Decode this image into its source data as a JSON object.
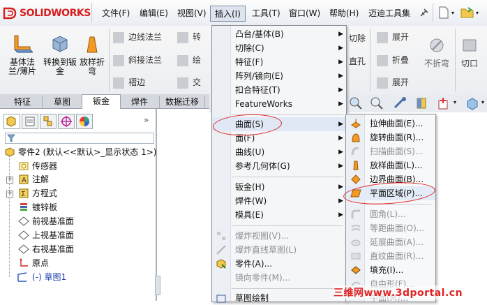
{
  "app": {
    "logo_text": "SOLIDWORKS",
    "menu": [
      "文件(F)",
      "编辑(E)",
      "视图(V)",
      "插入(I)",
      "工具(T)",
      "窗口(W)",
      "帮助(H)",
      "迈迪工具集"
    ]
  },
  "ribbon": {
    "big_buttons": [
      {
        "label": "基体法兰/薄片",
        "icon": "base-flange-icon"
      },
      {
        "label": "转换到钣金",
        "icon": "convert-sheet-metal-icon"
      },
      {
        "label": "放样折弯",
        "icon": "lofted-bend-icon"
      }
    ],
    "small_buttons": [
      {
        "label": "边线法兰",
        "icon": "edge-flange-icon"
      },
      {
        "label": "斜接法兰",
        "icon": "miter-flange-icon"
      },
      {
        "label": "褶边",
        "icon": "hem-icon"
      },
      {
        "label": "转",
        "icon": "jog-icon"
      },
      {
        "label": "绘",
        "icon": "sketched-bend-icon"
      },
      {
        "label": "交",
        "icon": "cross-break-icon"
      }
    ],
    "right_buttons": [
      {
        "label": "切除",
        "icon": "cut-icon"
      },
      {
        "label": "直孔",
        "icon": "hole-icon"
      },
      {
        "label": "展开",
        "icon": "unfold-icon"
      },
      {
        "label": "折叠",
        "icon": "fold-icon"
      },
      {
        "label": "展开",
        "icon": "flatten-icon"
      },
      {
        "label": "不折弯",
        "icon": "no-bends-icon"
      },
      {
        "label": "切口",
        "icon": "rip-icon"
      }
    ]
  },
  "tabs": [
    "特征",
    "草图",
    "钣金",
    "焊件",
    "数据迁移"
  ],
  "active_tab": "钣金",
  "feature_tree": {
    "root": "零件2 (默认<<默认>_显示状态 1>)",
    "items": [
      {
        "label": "传感器",
        "icon": "sensor-icon",
        "expander": ""
      },
      {
        "label": "注解",
        "icon": "annotation-icon",
        "expander": "+"
      },
      {
        "label": "方程式",
        "icon": "equation-icon",
        "expander": "+"
      },
      {
        "label": "镀锌板",
        "icon": "material-icon",
        "expander": ""
      },
      {
        "label": "前视基准面",
        "icon": "plane-icon",
        "expander": ""
      },
      {
        "label": "上视基准面",
        "icon": "plane-icon",
        "expander": ""
      },
      {
        "label": "右视基准面",
        "icon": "plane-icon",
        "expander": ""
      },
      {
        "label": "原点",
        "icon": "origin-icon",
        "expander": ""
      },
      {
        "label": "(-) 草图1",
        "icon": "sketch-icon",
        "expander": ""
      }
    ]
  },
  "insert_menu": {
    "items": [
      {
        "label": "凸台/基体(B)",
        "submenu": true,
        "disabled": false
      },
      {
        "label": "切除(C)",
        "submenu": true,
        "disabled": false
      },
      {
        "label": "特征(F)",
        "submenu": true,
        "disabled": false
      },
      {
        "label": "阵列/镜向(E)",
        "submenu": true,
        "disabled": false
      },
      {
        "label": "扣合特征(T)",
        "submenu": true,
        "disabled": false
      },
      {
        "label": "FeatureWorks",
        "submenu": true,
        "disabled": false
      },
      {
        "label": "曲面(S)",
        "submenu": true,
        "disabled": false
      },
      {
        "label": "面(F)",
        "submenu": true,
        "disabled": false
      },
      {
        "label": "曲线(U)",
        "submenu": true,
        "disabled": false
      },
      {
        "label": "参考几何体(G)",
        "submenu": true,
        "disabled": false
      },
      {
        "label": "钣金(H)",
        "submenu": true,
        "disabled": false
      },
      {
        "label": "焊件(W)",
        "submenu": true,
        "disabled": false
      },
      {
        "label": "模具(E)",
        "submenu": true,
        "disabled": false
      },
      {
        "label": "爆炸视图(V)...",
        "submenu": false,
        "disabled": true
      },
      {
        "label": "爆炸直线草图(L)",
        "submenu": false,
        "disabled": true
      },
      {
        "label": "零件(A)...",
        "submenu": false,
        "disabled": false
      },
      {
        "label": "镜向零件(M)...",
        "submenu": false,
        "disabled": true
      },
      {
        "label": "草图绘制",
        "submenu": false,
        "disabled": false
      }
    ]
  },
  "surface_submenu": {
    "items": [
      {
        "label": "拉伸曲面(E)...",
        "icon": "extruded-surface-icon",
        "disabled": false
      },
      {
        "label": "旋转曲面(R)...",
        "icon": "revolved-surface-icon",
        "disabled": false
      },
      {
        "label": "扫描曲面(S)...",
        "icon": "swept-surface-icon",
        "disabled": true
      },
      {
        "label": "放样曲面(L)...",
        "icon": "lofted-surface-icon",
        "disabled": false
      },
      {
        "label": "边界曲面(B)...",
        "icon": "boundary-surface-icon",
        "disabled": false
      },
      {
        "label": "平面区域(P)...",
        "icon": "planar-surface-icon",
        "disabled": false
      },
      {
        "label": "圆角(L)...",
        "icon": "fillet-icon",
        "disabled": true
      },
      {
        "label": "等距曲面(O)...",
        "icon": "offset-surface-icon",
        "disabled": true
      },
      {
        "label": "延展曲面(A)...",
        "icon": "radiate-surface-icon",
        "disabled": true
      },
      {
        "label": "直纹曲面(R)...",
        "icon": "ruled-surface-icon",
        "disabled": true
      },
      {
        "label": "填充(I)...",
        "icon": "fill-surface-icon",
        "disabled": false
      },
      {
        "label": "自由形(F)...",
        "icon": "freeform-icon",
        "disabled": true
      },
      {
        "label": "中面(M)...",
        "icon": "mid-surface-icon",
        "disabled": true
      }
    ]
  },
  "watermark": "三维网www.3dportal.cn"
}
